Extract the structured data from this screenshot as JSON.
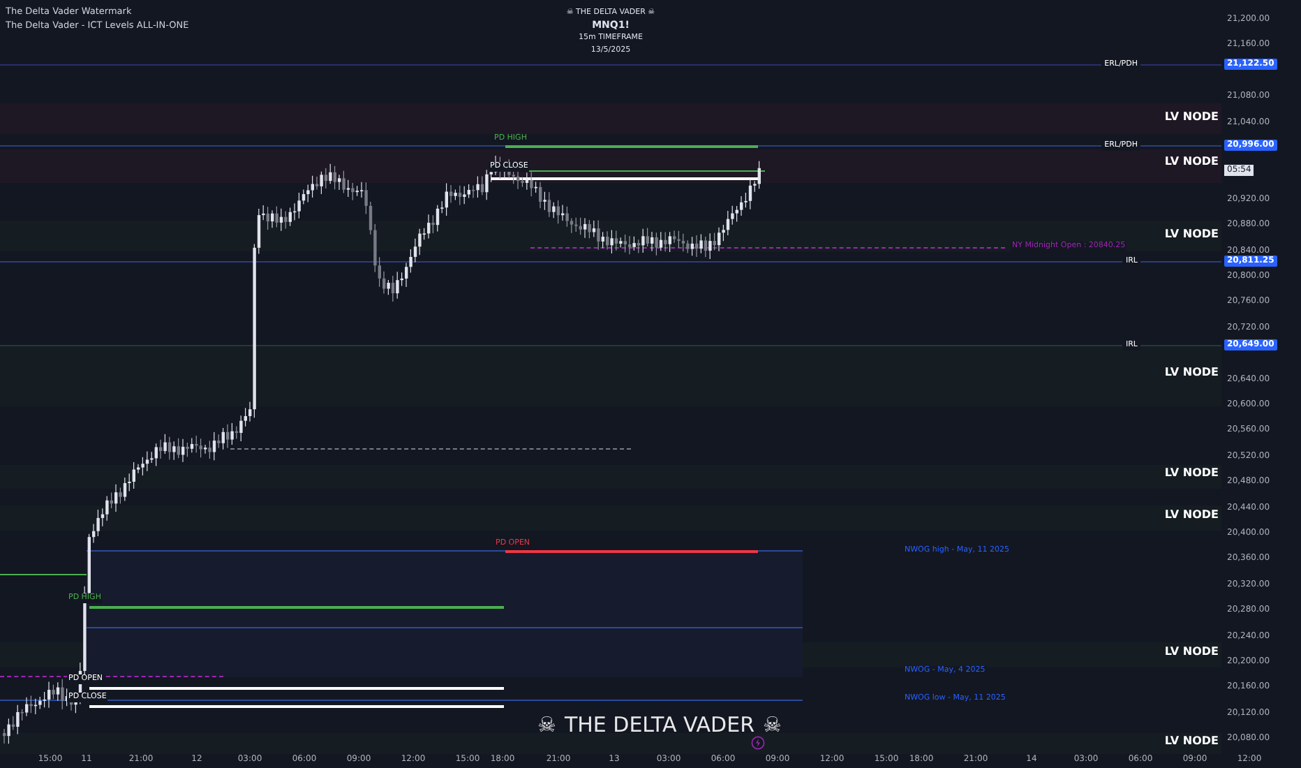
{
  "indicators": [
    "The Delta Vader Watermark",
    "The Delta Vader - ICT Levels ALL-IN-ONE"
  ],
  "header": {
    "brand": "☠ THE DELTA VADER ☠",
    "symbol": "MNQ1!",
    "timeframe": "15m TIMEFRAME",
    "date": "13/5/2025"
  },
  "price_axis": [
    "21,200.00",
    "21,160.00",
    "21,080.00",
    "21,040.00",
    "20,920.00",
    "20,880.00",
    "20,840.00",
    "20,800.00",
    "20,760.00",
    "20,720.00",
    "20,640.00",
    "20,600.00",
    "20,560.00",
    "20,520.00",
    "20,480.00",
    "20,440.00",
    "20,400.00",
    "20,360.00",
    "20,320.00",
    "20,280.00",
    "20,240.00",
    "20,200.00",
    "20,160.00",
    "20,120.00",
    "20,080.00"
  ],
  "price_tags": [
    {
      "label": "ERL/PDH",
      "value": "21,122.50"
    },
    {
      "label": "ERL/PDH",
      "value": "20,996.00"
    },
    {
      "label": "IRL",
      "value": "20,811.25"
    },
    {
      "label": "IRL",
      "value": "20,649.00"
    }
  ],
  "countdown": "05:54",
  "zones": [
    {
      "label": "LV NODE",
      "kind": "supply"
    },
    {
      "label": "LV NODE",
      "kind": "supply"
    },
    {
      "label": "LV NODE",
      "kind": "demand"
    },
    {
      "label": "LV NODE",
      "kind": "demand"
    },
    {
      "label": "LV NODE",
      "kind": "demand"
    },
    {
      "label": "LV NODE",
      "kind": "demand"
    },
    {
      "label": "LV NODE",
      "kind": "demand"
    },
    {
      "label": "LV NODE",
      "kind": "demand"
    }
  ],
  "levels": [
    {
      "label": "PD HIGH",
      "color": "#4caf50"
    },
    {
      "label": "PD CLOSE",
      "color": "#ffffff"
    },
    {
      "label": "NY Midnight Open : 20840.25",
      "color": "#9c27b0"
    },
    {
      "label": "PD OPEN",
      "color": "#f23645"
    },
    {
      "label": "PD HIGH",
      "color": "#4caf50"
    },
    {
      "label": "PD OPEN",
      "color": "#ffffff"
    },
    {
      "label": "PD CLOSE",
      "color": "#ffffff"
    },
    {
      "label": "NWOG high - May, 11 2025",
      "color": "#2962ff"
    },
    {
      "label": "NWOG - May, 4 2025",
      "color": "#2962ff"
    },
    {
      "label": "NWOG low - May, 11 2025",
      "color": "#2962ff"
    }
  ],
  "time_axis": [
    "15:00",
    "11",
    "21:00",
    "12",
    "03:00",
    "06:00",
    "09:00",
    "12:00",
    "15:00",
    "18:00",
    "21:00",
    "13",
    "03:00",
    "06:00",
    "09:00",
    "12:00",
    "15:00",
    "18:00",
    "21:00",
    "14",
    "03:00",
    "06:00",
    "09:00",
    "12:00"
  ],
  "watermark": {
    "text": "THE DELTA VADER",
    "icon": "☠"
  }
}
